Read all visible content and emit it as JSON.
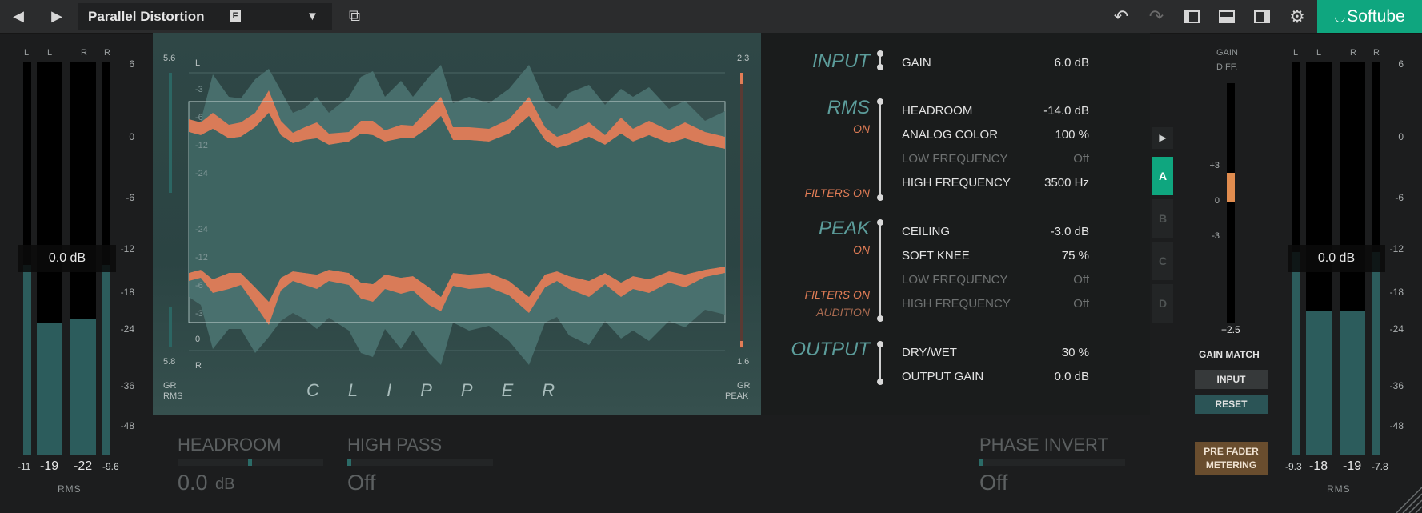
{
  "topbar": {
    "prev_icon": "◀",
    "next_icon": "▶",
    "preset_name": "Parallel Distortion",
    "preset_flag": "F",
    "dropdown_icon": "▼",
    "window_icon": "⧉",
    "undo_icon": "↶",
    "redo_icon": "↷",
    "layout1_icon": "▯",
    "layout2_icon": "▭",
    "layout3_icon": "▯",
    "settings_icon": "⚙",
    "brand": "Softube",
    "brand_color": "#0fa67f"
  },
  "left_meter": {
    "channels": [
      "L",
      "L",
      "R",
      "R"
    ],
    "scale": [
      "6",
      "0",
      "-6",
      "-12",
      "-18",
      "-24",
      "-36",
      "-48"
    ],
    "db_box": "0.0 dB",
    "readouts": [
      "-11",
      "-19",
      "-22",
      "-9.6"
    ],
    "caption": "RMS",
    "levels": [
      0.62,
      0.43,
      0.44,
      0.62
    ]
  },
  "display": {
    "gr_rms_top": "5.6",
    "gr_rms_bottom": "5.8",
    "gr_peak_top": "2.3",
    "gr_peak_bottom": "1.6",
    "channel_top": "L",
    "channel_bottom": "R",
    "grid_top": [
      "-3",
      "-6",
      "-12",
      "-24"
    ],
    "grid_bottom": [
      "-24",
      "-12",
      "-6",
      "-3",
      "0"
    ],
    "gr_rms_label_1": "GR",
    "gr_rms_label_2": "RMS",
    "gr_peak_label_1": "GR",
    "gr_peak_label_2": "PEAK",
    "title": "CLIPPER",
    "accent_teal": "#5c9d9b",
    "accent_orange": "#e27d56"
  },
  "params": {
    "input": {
      "title": "INPUT",
      "rows": [
        {
          "name": "GAIN",
          "value": "6.0 dB"
        }
      ]
    },
    "rms": {
      "title": "RMS",
      "status": "ON",
      "filters": "FILTERS ON",
      "rows": [
        {
          "name": "HEADROOM",
          "value": "-14.0 dB"
        },
        {
          "name": "ANALOG COLOR",
          "value": "100 %"
        },
        {
          "name": "LOW FREQUENCY",
          "value": "Off"
        },
        {
          "name": "HIGH FREQUENCY",
          "value": "3500 Hz"
        }
      ]
    },
    "peak": {
      "title": "PEAK",
      "status": "ON",
      "filters": "FILTERS ON",
      "audition": "AUDITION",
      "rows": [
        {
          "name": "CEILING",
          "value": "-3.0 dB"
        },
        {
          "name": "SOFT KNEE",
          "value": "75 %"
        },
        {
          "name": "LOW FREQUENCY",
          "value": "Off"
        },
        {
          "name": "HIGH FREQUENCY",
          "value": "Off"
        }
      ]
    },
    "output": {
      "title": "OUTPUT",
      "rows": [
        {
          "name": "DRY/WET",
          "value": "30 %"
        },
        {
          "name": "OUTPUT GAIN",
          "value": "0.0 dB"
        }
      ]
    }
  },
  "snapshots": {
    "expand_icon": "▶",
    "slots": [
      "A",
      "B",
      "C",
      "D"
    ],
    "active": "A"
  },
  "gain_diff": {
    "label_1": "GAIN",
    "label_2": "DIFF.",
    "scale": [
      "+3",
      "0",
      "-3"
    ],
    "readout": "+2.5",
    "gain_match": "GAIN MATCH",
    "input_button": "INPUT",
    "reset_button": "RESET",
    "pre_fader_1": "PRE FADER",
    "pre_fader_2": "METERING"
  },
  "right_meter": {
    "channels": [
      "L",
      "L",
      "R",
      "R"
    ],
    "scale": [
      "6",
      "0",
      "-6",
      "-12",
      "-18",
      "-24",
      "-36",
      "-48"
    ],
    "db_box": "0.0 dB",
    "readouts": [
      "-9.3",
      "-18",
      "-19",
      "-7.8"
    ],
    "caption": "RMS",
    "levels": [
      0.66,
      0.47,
      0.47,
      0.66
    ]
  },
  "bottom": {
    "headroom_label": "HEADROOM",
    "headroom_value": "0.0",
    "headroom_unit": "dB",
    "highpass_label": "HIGH PASS",
    "highpass_value": "Off",
    "phase_label": "PHASE INVERT",
    "phase_value": "Off"
  }
}
